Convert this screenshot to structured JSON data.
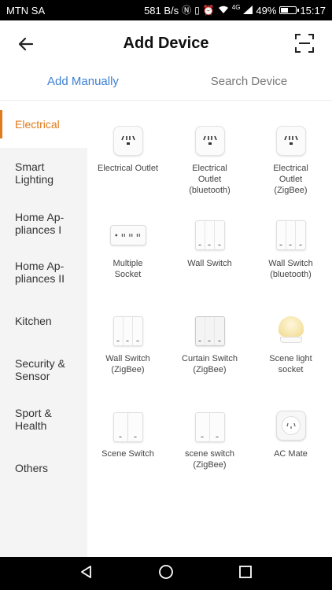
{
  "status_bar": {
    "carrier": "MTN SA",
    "network_speed": "581 B/s",
    "signal_label": "4G",
    "battery_percent": "49%",
    "battery_level": 0.49,
    "time": "15:17"
  },
  "header": {
    "title": "Add Device",
    "back_icon": "back-arrow-icon",
    "scan_icon": "scan-icon"
  },
  "tabs": [
    {
      "label": "Add Manually",
      "active": true
    },
    {
      "label": "Search Device",
      "active": false
    }
  ],
  "sidebar": {
    "items": [
      {
        "label": "Electrical",
        "active": true
      },
      {
        "label": "Smart Lighting",
        "active": false
      },
      {
        "label": "Home Ap-pliances I",
        "active": false
      },
      {
        "label": "Home Ap-pliances II",
        "active": false
      },
      {
        "label": "Kitchen",
        "active": false
      },
      {
        "label": "Security & Sensor",
        "active": false
      },
      {
        "label": "Sport & Health",
        "active": false
      },
      {
        "label": "Others",
        "active": false
      }
    ]
  },
  "devices": [
    {
      "label": "Electrical Outlet",
      "icon": "outlet-icon"
    },
    {
      "label": "Electrical Outlet (bluetooth)",
      "icon": "outlet-icon"
    },
    {
      "label": "Electrical Outlet (ZigBee)",
      "icon": "outlet-icon"
    },
    {
      "label": "Multiple Socket",
      "icon": "power-strip-icon"
    },
    {
      "label": "Wall Switch",
      "icon": "wall-switch-icon"
    },
    {
      "label": "Wall Switch (bluetooth)",
      "icon": "wall-switch-icon"
    },
    {
      "label": "Wall Switch (ZigBee)",
      "icon": "wall-switch-icon"
    },
    {
      "label": "Curtain Switch (ZigBee)",
      "icon": "curtain-switch-icon"
    },
    {
      "label": "Scene light socket",
      "icon": "lamp-icon"
    },
    {
      "label": "Scene Switch",
      "icon": "scene-switch-icon"
    },
    {
      "label": "scene switch (ZigBee)",
      "icon": "scene-switch-icon"
    },
    {
      "label": "AC Mate",
      "icon": "ac-mate-icon"
    }
  ],
  "nav_bar": {
    "back_icon": "nav-back-icon",
    "home_icon": "nav-home-icon",
    "recents_icon": "nav-recents-icon"
  },
  "colors": {
    "accent_blue": "#3d7fd6",
    "accent_orange": "#e07a1a",
    "sidebar_bg": "#f4f4f4"
  }
}
